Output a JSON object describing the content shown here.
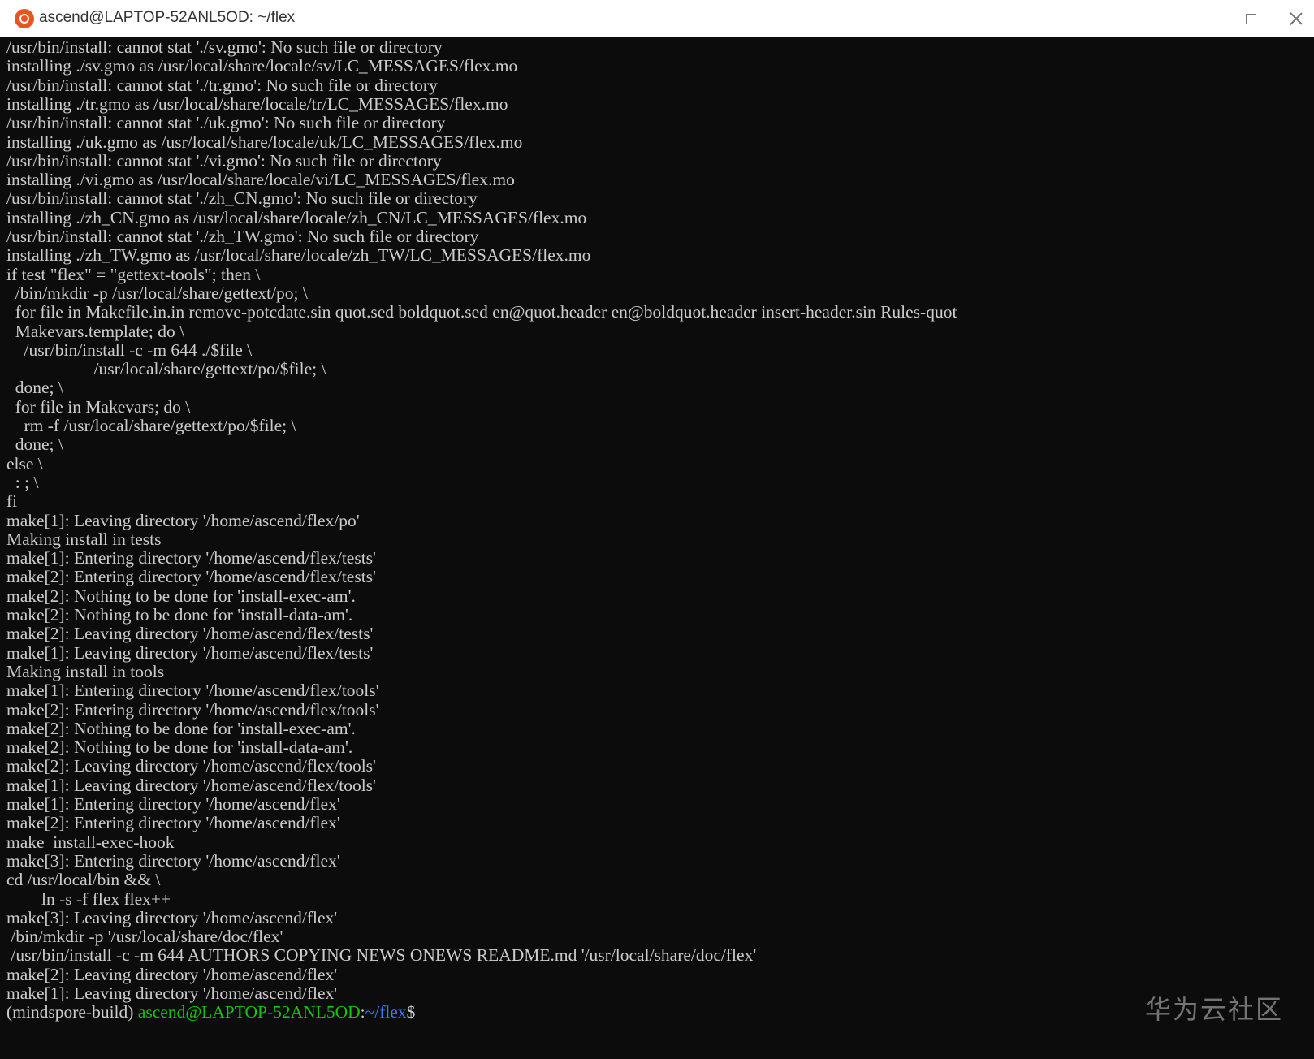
{
  "window": {
    "title": "ascend@LAPTOP-52ANL5OD: ~/flex",
    "icon": "ubuntu-logo-icon",
    "accent_color": "#e95420",
    "controls": [
      "minimize-icon",
      "maximize-icon",
      "close-icon"
    ]
  },
  "terminal": {
    "background": "#0c0c0c",
    "foreground": "#cccccc",
    "lines": [
      "/usr/bin/install: cannot stat './sv.gmo': No such file or directory",
      "installing ./sv.gmo as /usr/local/share/locale/sv/LC_MESSAGES/flex.mo",
      "/usr/bin/install: cannot stat './tr.gmo': No such file or directory",
      "installing ./tr.gmo as /usr/local/share/locale/tr/LC_MESSAGES/flex.mo",
      "/usr/bin/install: cannot stat './uk.gmo': No such file or directory",
      "installing ./uk.gmo as /usr/local/share/locale/uk/LC_MESSAGES/flex.mo",
      "/usr/bin/install: cannot stat './vi.gmo': No such file or directory",
      "installing ./vi.gmo as /usr/local/share/locale/vi/LC_MESSAGES/flex.mo",
      "/usr/bin/install: cannot stat './zh_CN.gmo': No such file or directory",
      "installing ./zh_CN.gmo as /usr/local/share/locale/zh_CN/LC_MESSAGES/flex.mo",
      "/usr/bin/install: cannot stat './zh_TW.gmo': No such file or directory",
      "installing ./zh_TW.gmo as /usr/local/share/locale/zh_TW/LC_MESSAGES/flex.mo",
      "if test \"flex\" = \"gettext-tools\"; then \\",
      "  /bin/mkdir -p /usr/local/share/gettext/po; \\",
      "  for file in Makefile.in.in remove-potcdate.sin quot.sed boldquot.sed en@quot.header en@boldquot.header insert-header.sin Rules-quot",
      "  Makevars.template; do \\",
      "    /usr/bin/install -c -m 644 ./$file \\",
      "                    /usr/local/share/gettext/po/$file; \\",
      "  done; \\",
      "  for file in Makevars; do \\",
      "    rm -f /usr/local/share/gettext/po/$file; \\",
      "  done; \\",
      "else \\",
      "  : ; \\",
      "fi",
      "make[1]: Leaving directory '/home/ascend/flex/po'",
      "Making install in tests",
      "make[1]: Entering directory '/home/ascend/flex/tests'",
      "make[2]: Entering directory '/home/ascend/flex/tests'",
      "make[2]: Nothing to be done for 'install-exec-am'.",
      "make[2]: Nothing to be done for 'install-data-am'.",
      "make[2]: Leaving directory '/home/ascend/flex/tests'",
      "make[1]: Leaving directory '/home/ascend/flex/tests'",
      "Making install in tools",
      "make[1]: Entering directory '/home/ascend/flex/tools'",
      "make[2]: Entering directory '/home/ascend/flex/tools'",
      "make[2]: Nothing to be done for 'install-exec-am'.",
      "make[2]: Nothing to be done for 'install-data-am'.",
      "make[2]: Leaving directory '/home/ascend/flex/tools'",
      "make[1]: Leaving directory '/home/ascend/flex/tools'",
      "make[1]: Entering directory '/home/ascend/flex'",
      "make[2]: Entering directory '/home/ascend/flex'",
      "make  install-exec-hook",
      "make[3]: Entering directory '/home/ascend/flex'",
      "cd /usr/local/bin && \\",
      "        ln -s -f flex flex++",
      "make[3]: Leaving directory '/home/ascend/flex'",
      " /bin/mkdir -p '/usr/local/share/doc/flex'",
      " /usr/bin/install -c -m 644 AUTHORS COPYING NEWS ONEWS README.md '/usr/local/share/doc/flex'",
      "make[2]: Leaving directory '/home/ascend/flex'",
      "make[1]: Leaving directory '/home/ascend/flex'"
    ],
    "prompt": {
      "env": "(mindspore-build) ",
      "user_host": "ascend@LAPTOP-52ANL5OD",
      "colon": ":",
      "path": "~/flex",
      "dollar": "$",
      "user_color": "#16c60c",
      "path_color": "#3b78ff"
    }
  },
  "watermark": "华为云社区"
}
